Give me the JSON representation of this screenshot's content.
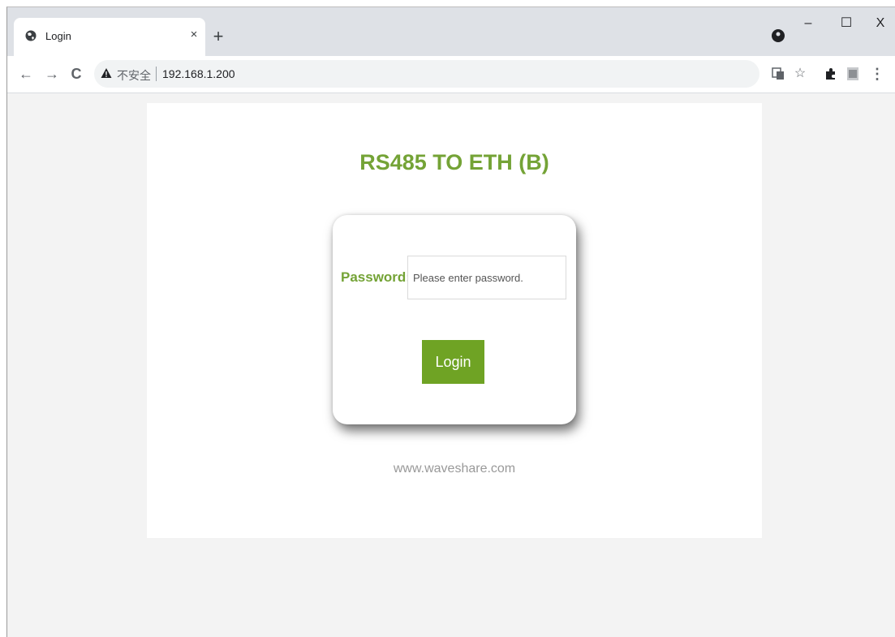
{
  "browser": {
    "tab": {
      "title": "Login",
      "close_glyph": "×"
    },
    "new_tab_glyph": "+",
    "window_controls": {
      "minimize": "–",
      "maximize": "☐",
      "close": "X"
    },
    "nav": {
      "back": "←",
      "forward": "→",
      "reload": "C"
    },
    "address_bar": {
      "security_label": "不安全",
      "url": "192.168.1.200"
    },
    "toolbar_icons": {
      "bookmark": "☆",
      "menu": "⋮"
    }
  },
  "page": {
    "title": "RS485 TO ETH (B)",
    "password_label": "Password:",
    "password_placeholder": "Please enter password.",
    "login_button": "Login",
    "footer_link": "www.waveshare.com"
  },
  "colors": {
    "accent_green": "#74a336",
    "button_green": "#6fa324",
    "footer_gray": "#999999"
  }
}
